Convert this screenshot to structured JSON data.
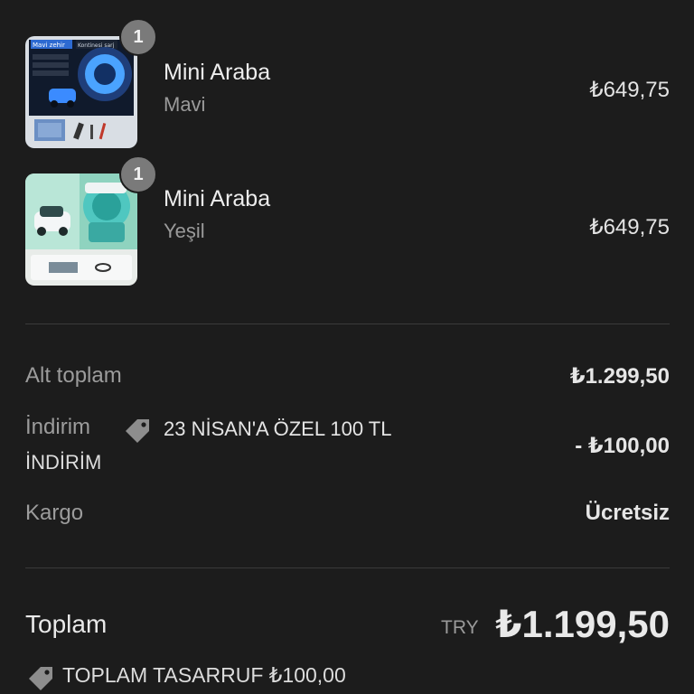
{
  "cart": {
    "items": [
      {
        "name": "Mini Araba",
        "variant": "Mavi",
        "price": "₺649,75",
        "quantity": "1",
        "image_text": [
          "Mavi zehir",
          "Kontinesi şarj"
        ]
      },
      {
        "name": "Mini Araba",
        "variant": "Yeşil",
        "price": "₺649,75",
        "quantity": "1"
      }
    ]
  },
  "summary": {
    "subtotal_label": "Alt toplam",
    "subtotal_value": "₺1.299,50",
    "discount_label": "İndirim",
    "discount_label_cont": "İNDİRİM",
    "discount_code": "23 NİSAN'A ÖZEL 100 TL",
    "discount_value": "- ₺100,00",
    "shipping_label": "Kargo",
    "shipping_value": "Ücretsiz"
  },
  "total": {
    "label": "Toplam",
    "currency": "TRY",
    "value": "₺1.199,50",
    "savings_text": "TOPLAM TASARRUF ₺100,00"
  },
  "icons": {
    "tag": "tag-icon"
  },
  "colors": {
    "background": "#1c1c1c",
    "divider": "#3a3a3a",
    "badge": "#7a7a7a",
    "muted_text": "#9c9c9c"
  }
}
